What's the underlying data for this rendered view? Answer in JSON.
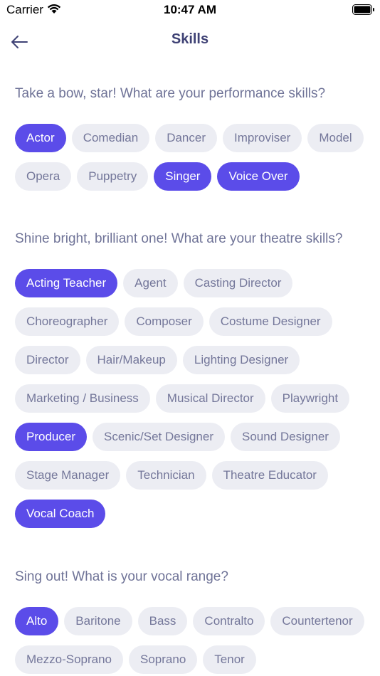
{
  "status_bar": {
    "carrier": "Carrier",
    "time": "10:47 AM"
  },
  "header": {
    "title": "Skills"
  },
  "sections": [
    {
      "title": "Take a bow, star! What are your performance skills?",
      "chips": [
        {
          "label": "Actor",
          "selected": true
        },
        {
          "label": "Comedian",
          "selected": false
        },
        {
          "label": "Dancer",
          "selected": false
        },
        {
          "label": "Improviser",
          "selected": false
        },
        {
          "label": "Model",
          "selected": false
        },
        {
          "label": "Opera",
          "selected": false
        },
        {
          "label": "Puppetry",
          "selected": false
        },
        {
          "label": "Singer",
          "selected": true
        },
        {
          "label": "Voice Over",
          "selected": true
        }
      ]
    },
    {
      "title": "Shine bright, brilliant one! What are your theatre skills?",
      "chips": [
        {
          "label": "Acting Teacher",
          "selected": true
        },
        {
          "label": "Agent",
          "selected": false
        },
        {
          "label": "Casting Director",
          "selected": false
        },
        {
          "label": "Choreographer",
          "selected": false
        },
        {
          "label": "Composer",
          "selected": false
        },
        {
          "label": "Costume Designer",
          "selected": false
        },
        {
          "label": "Director",
          "selected": false
        },
        {
          "label": "Hair/Makeup",
          "selected": false
        },
        {
          "label": "Lighting Designer",
          "selected": false
        },
        {
          "label": "Marketing / Business",
          "selected": false
        },
        {
          "label": "Musical Director",
          "selected": false
        },
        {
          "label": "Playwright",
          "selected": false
        },
        {
          "label": "Producer",
          "selected": true
        },
        {
          "label": "Scenic/Set Designer",
          "selected": false
        },
        {
          "label": "Sound Designer",
          "selected": false
        },
        {
          "label": "Stage Manager",
          "selected": false
        },
        {
          "label": "Technician",
          "selected": false
        },
        {
          "label": "Theatre Educator",
          "selected": false
        },
        {
          "label": "Vocal Coach",
          "selected": true
        }
      ]
    },
    {
      "title": "Sing out! What is your vocal range?",
      "chips": [
        {
          "label": "Alto",
          "selected": true
        },
        {
          "label": "Baritone",
          "selected": false
        },
        {
          "label": "Bass",
          "selected": false
        },
        {
          "label": "Contralto",
          "selected": false
        },
        {
          "label": "Countertenor",
          "selected": false
        },
        {
          "label": "Mezzo-Soprano",
          "selected": false
        },
        {
          "label": "Soprano",
          "selected": false
        },
        {
          "label": "Tenor",
          "selected": false
        }
      ]
    }
  ],
  "colors": {
    "accent": "#5b4ce9",
    "chip_bg": "#ecedf3",
    "title": "#3f4275"
  }
}
